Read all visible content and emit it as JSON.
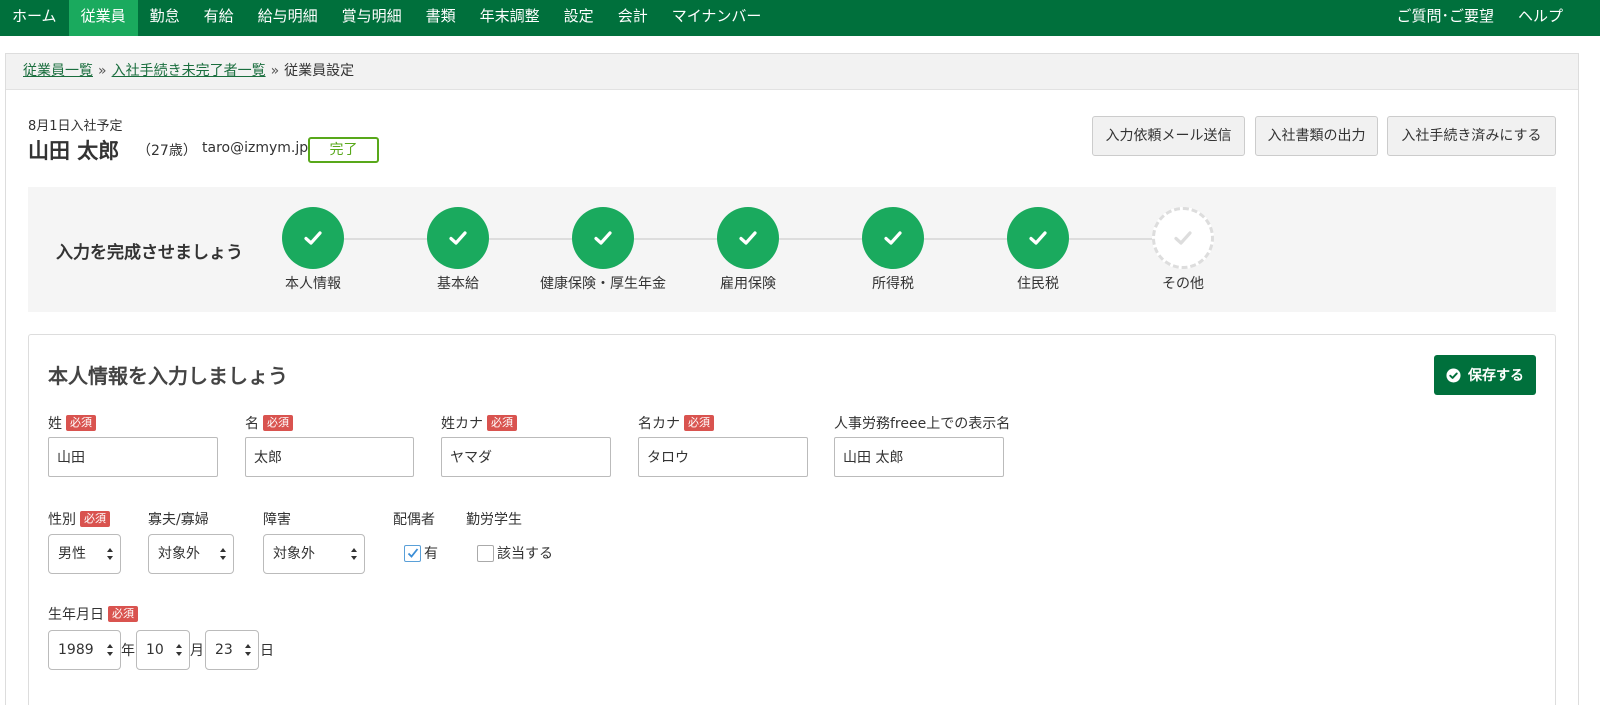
{
  "nav": {
    "left": [
      {
        "label": "ホーム",
        "active": false
      },
      {
        "label": "従業員",
        "active": true
      },
      {
        "label": "勤怠",
        "active": false
      },
      {
        "label": "有給",
        "active": false
      },
      {
        "label": "給与明細",
        "active": false
      },
      {
        "label": "賞与明細",
        "active": false
      },
      {
        "label": "書類",
        "active": false
      },
      {
        "label": "年末調整",
        "active": false
      },
      {
        "label": "設定",
        "active": false
      },
      {
        "label": "会計",
        "active": false
      },
      {
        "label": "マイナンバー",
        "active": false
      }
    ],
    "right": [
      {
        "label": "ご質問･ご要望"
      },
      {
        "label": "ヘルプ"
      }
    ]
  },
  "breadcrumb": {
    "items": [
      "従業員一覧",
      "入社手続き未完了者一覧"
    ],
    "separator": "»",
    "current": "従業員設定"
  },
  "employee": {
    "schedule": "8月1日入社予定",
    "name": "山田 太郎",
    "age": "（27歳）",
    "email": "taro@izmym.jp",
    "status": "完了"
  },
  "actions": {
    "send_mail": "入力依頼メール送信",
    "export_docs": "入社書類の出力",
    "mark_complete": "入社手続き済みにする"
  },
  "progress": {
    "title": "入力を完成させましょう",
    "steps": [
      {
        "label": "本人情報",
        "done": true
      },
      {
        "label": "基本給",
        "done": true
      },
      {
        "label": "健康保険・厚生年金",
        "done": true
      },
      {
        "label": "雇用保険",
        "done": true
      },
      {
        "label": "所得税",
        "done": true
      },
      {
        "label": "住民税",
        "done": true
      },
      {
        "label": "その他",
        "done": false
      }
    ]
  },
  "form": {
    "title": "本人情報を入力しましょう",
    "save_label": "保存する",
    "required_label": "必須",
    "last_name": {
      "label": "姓",
      "value": "山田"
    },
    "first_name": {
      "label": "名",
      "value": "太郎"
    },
    "last_name_kana": {
      "label": "姓カナ",
      "value": "ヤマダ"
    },
    "first_name_kana": {
      "label": "名カナ",
      "value": "タロウ"
    },
    "display_name": {
      "label": "人事労務freee上での表示名",
      "value": "山田 太郎"
    },
    "gender": {
      "label": "性別",
      "value": "男性"
    },
    "widow": {
      "label": "寡夫/寡婦",
      "value": "対象外"
    },
    "disability": {
      "label": "障害",
      "value": "対象外"
    },
    "spouse": {
      "label": "配偶者",
      "option": "有",
      "checked": true
    },
    "working_student": {
      "label": "勤労学生",
      "option": "該当する",
      "checked": false
    },
    "birthdate": {
      "label": "生年月日",
      "year": "1989",
      "year_unit": "年",
      "month": "10",
      "month_unit": "月",
      "day": "23",
      "day_unit": "日"
    }
  },
  "colors": {
    "brand_green": "#00703c",
    "active_green": "#1aaa5e",
    "required_red": "#d9534f",
    "complete_badge": "#58a81a"
  }
}
